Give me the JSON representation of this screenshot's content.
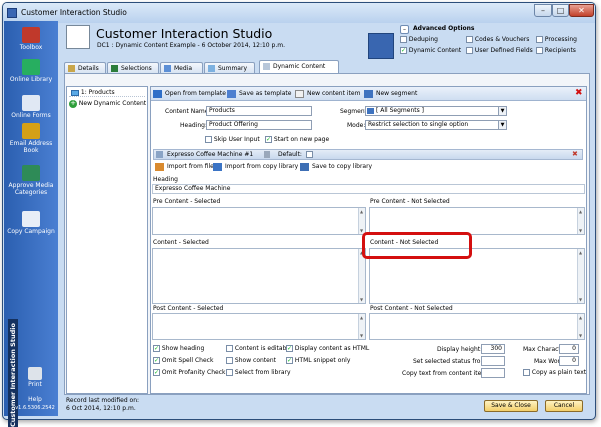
{
  "window": {
    "title": "Customer Interaction Studio"
  },
  "sidebar": {
    "items": [
      {
        "label": "Toolbox",
        "color": "#c0392b"
      },
      {
        "label": "Online Library",
        "color": "#27ae60"
      },
      {
        "label": "Online Forms",
        "color": "#e0e8f4"
      },
      {
        "label": "Email Address Book",
        "color": "#d4a017"
      },
      {
        "label": "Approve Media Categories",
        "color": "#2e8b57"
      },
      {
        "label": "Copy Campaign",
        "color": "#e8eef7"
      },
      {
        "label": "Print",
        "color": "#dde3ea"
      },
      {
        "label": "Help",
        "color": "#3a6fb8"
      }
    ],
    "version": "v1.6.5306.2542",
    "vertical_label": "Customer Interaction Studio"
  },
  "header": {
    "title": "Customer Interaction Studio",
    "subtitle": "DC1 : Dynamic Content Example - 6 October 2014, 12:10 p.m."
  },
  "advanced": {
    "title": "Advanced Options",
    "options": [
      {
        "label": "Deduping",
        "checked": false
      },
      {
        "label": "Codes & Vouchers",
        "checked": false
      },
      {
        "label": "Processing",
        "checked": false
      },
      {
        "label": "Dynamic Content",
        "checked": true
      },
      {
        "label": "User Defined Fields",
        "checked": false
      },
      {
        "label": "Recipients",
        "checked": false
      }
    ]
  },
  "tabs": [
    "Details",
    "Selections",
    "Media",
    "Summary",
    "Dynamic Content"
  ],
  "list": {
    "items": [
      "1: Products",
      "New Dynamic Content"
    ]
  },
  "toolbar": {
    "open_template": "Open from template",
    "save_template": "Save as template",
    "new_item": "New content item",
    "new_segment": "New segment"
  },
  "form": {
    "content_name_label": "Content Name:",
    "content_name": "Products",
    "heading_label": "Heading:",
    "heading": "Product Offering",
    "segment_label": "Segment:",
    "segment": "[ All Segments ]",
    "mode_label": "Mode:",
    "mode": "Restrict selection to single option",
    "skip_user_input": "Skip User Input",
    "start_new_page": "Start on new page"
  },
  "item": {
    "title": "Expresso Coffee Machine #1",
    "default_label": "Default:",
    "import_file": "Import from file",
    "import_library": "Import from copy library",
    "save_library": "Save to copy library",
    "heading_label": "Heading",
    "heading_value": "Expresso Coffee Machine",
    "pre_selected": "Pre Content - Selected",
    "pre_not_selected": "Pre Content - Not Selected",
    "content_selected": "Content - Selected",
    "content_not_selected": "Content - Not Selected",
    "post_selected": "Post Content - Selected",
    "post_not_selected": "Post Content - Not Selected"
  },
  "options": {
    "show_heading": "Show heading",
    "omit_spell": "Omit Spell Check",
    "omit_profanity": "Omit Profanity Check",
    "content_editable": "Content is editable",
    "show_content": "Show content",
    "select_library": "Select from library",
    "display_html": "Display content as HTML",
    "html_snippet": "HTML snippet only",
    "display_height_label": "Display height:",
    "display_height": "300",
    "selected_status_label": "Set selected status from:",
    "copy_text_label": "Copy text from content item:",
    "max_chars_label": "Max Characters:",
    "max_chars": "0",
    "max_words_label": "Max Words:",
    "max_words": "0",
    "copy_plain": "Copy as plain text"
  },
  "footer": {
    "record_label": "Record last modified on:",
    "record_date": "6 Oct 2014, 12:10 p.m.",
    "save_close": "Save & Close",
    "cancel": "Cancel"
  }
}
